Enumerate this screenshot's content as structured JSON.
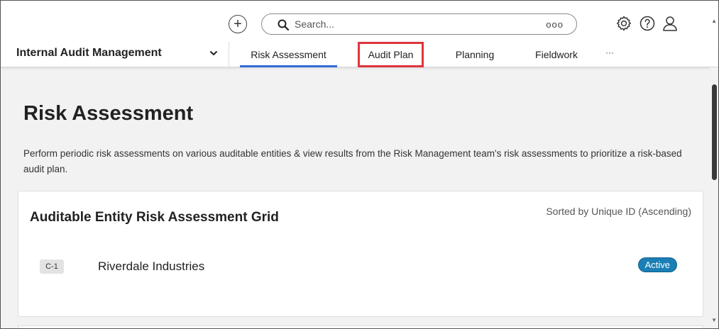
{
  "topbar": {
    "add_icon": "plus-circle-icon",
    "search": {
      "placeholder": "Search...",
      "more_label": "ooo"
    },
    "icons": [
      "gear-icon",
      "help-icon",
      "user-icon"
    ]
  },
  "nav": {
    "app_name": "Internal Audit Management",
    "tabs": [
      {
        "label": "Risk Assessment",
        "active": true
      },
      {
        "label": "Audit Plan",
        "highlighted": true
      },
      {
        "label": "Planning"
      },
      {
        "label": "Fieldwork"
      }
    ],
    "more_label": "···"
  },
  "page": {
    "title": "Risk Assessment",
    "description": "Perform periodic risk assessments on various auditable entities & view results from the Risk Management team's risk assessments to prioritize a risk-based audit plan."
  },
  "grid": {
    "title": "Auditable Entity Risk Assessment Grid",
    "sort_label": "Sorted by Unique ID (Ascending)",
    "rows": [
      {
        "id": "C-1",
        "name": "Riverdale Industries",
        "status": "Active"
      }
    ]
  },
  "colors": {
    "accent": "#2f6bd8",
    "highlight": "#e0343c",
    "status_active": "#1a7fb5"
  }
}
